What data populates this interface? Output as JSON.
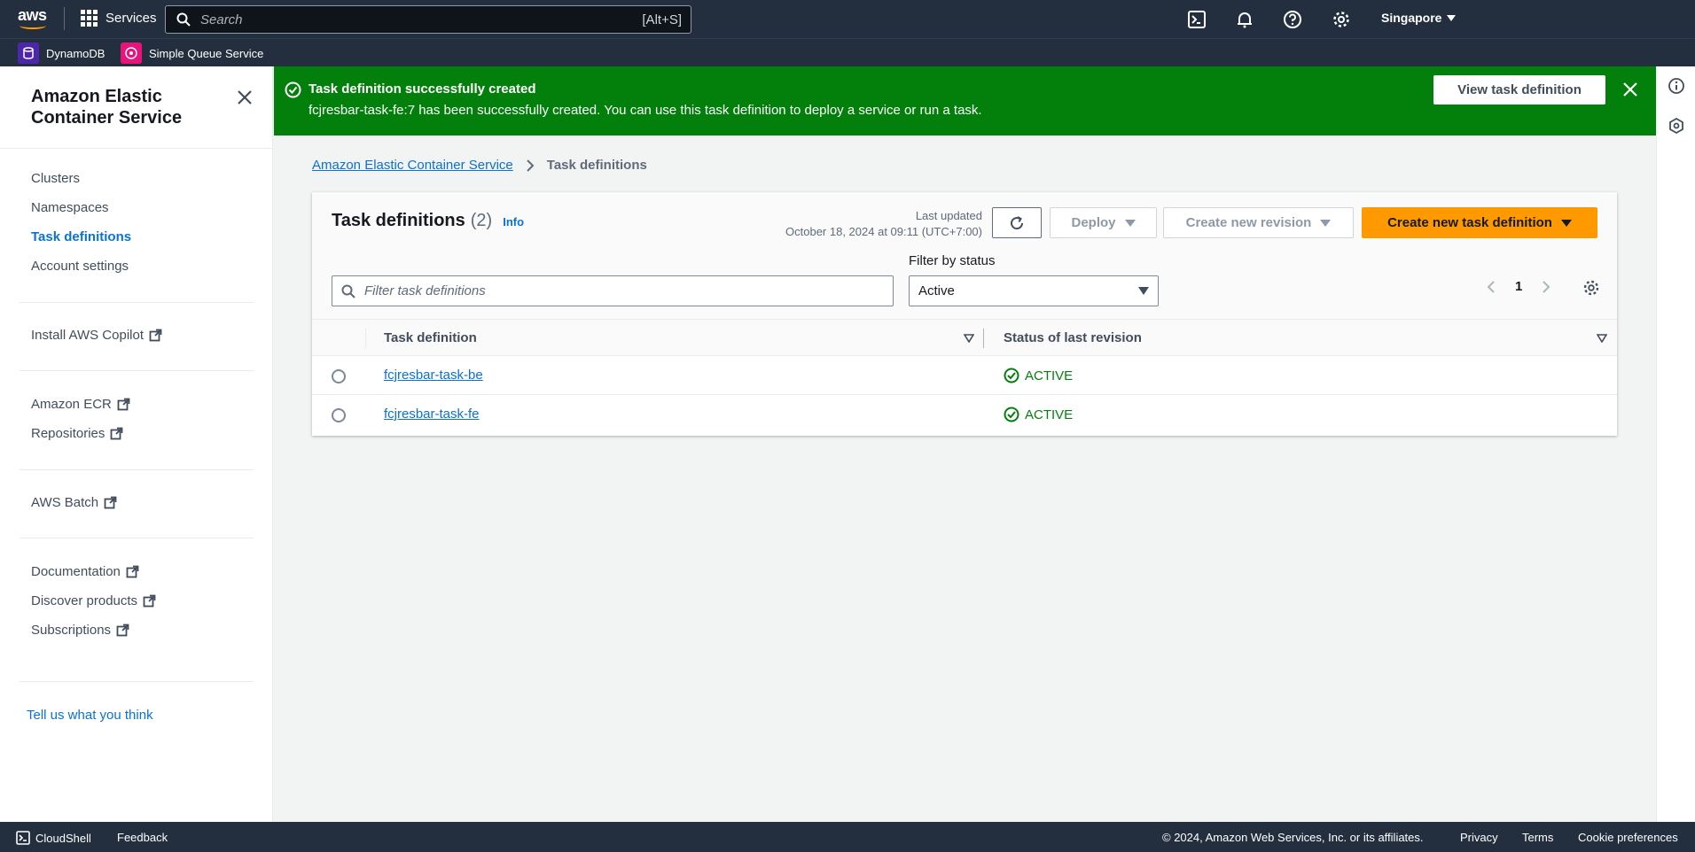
{
  "topnav": {
    "logo_text": "aws",
    "services_label": "Services",
    "search_placeholder": "Search",
    "search_shortcut": "[Alt+S]",
    "region": "Singapore"
  },
  "favorites": [
    {
      "label": "DynamoDB",
      "color": "#4d27aa"
    },
    {
      "label": "Simple Queue Service",
      "color": "#e7157b"
    }
  ],
  "sidebar": {
    "title": "Amazon Elastic Container Service",
    "groups": [
      [
        {
          "label": "Clusters",
          "active": false
        },
        {
          "label": "Namespaces",
          "active": false
        },
        {
          "label": "Task definitions",
          "active": true
        },
        {
          "label": "Account settings",
          "active": false
        }
      ],
      [
        {
          "label": "Install AWS Copilot",
          "external": true
        }
      ],
      [
        {
          "label": "Amazon ECR",
          "external": true
        },
        {
          "label": "Repositories",
          "external": true
        }
      ],
      [
        {
          "label": "AWS Batch",
          "external": true
        }
      ],
      [
        {
          "label": "Documentation",
          "external": true
        },
        {
          "label": "Discover products",
          "external": true
        },
        {
          "label": "Subscriptions",
          "external": true
        }
      ]
    ],
    "feedback": "Tell us what you think"
  },
  "flash": {
    "header": "Task definition successfully created",
    "body": "fcjresbar-task-fe:7 has been successfully created. You can use this task definition to deploy a service or run a task.",
    "button": "View task definition",
    "color": "#037f0c"
  },
  "breadcrumb": {
    "root": "Amazon Elastic Container Service",
    "current": "Task definitions"
  },
  "panel": {
    "title": "Task definitions",
    "count": "(2)",
    "info": "Info",
    "last_updated_label": "Last updated",
    "last_updated_value": "October 18, 2024 at 09:11 (UTC+7:00)",
    "deploy": "Deploy",
    "create_revision": "Create new revision",
    "create_new": "Create new task definition",
    "filter_placeholder": "Filter task definitions",
    "filter_status_label": "Filter by status",
    "filter_status_value": "Active",
    "page": "1",
    "columns": [
      "Task definition",
      "Status of last revision"
    ],
    "rows": [
      {
        "name": "fcjresbar-task-be",
        "status": "ACTIVE"
      },
      {
        "name": "fcjresbar-task-fe",
        "status": "ACTIVE"
      }
    ],
    "primary_color": "#ff9900"
  },
  "footer": {
    "cloudshell": "CloudShell",
    "feedback": "Feedback",
    "copyright": "© 2024, Amazon Web Services, Inc. or its affiliates.",
    "privacy": "Privacy",
    "terms": "Terms",
    "cookies": "Cookie preferences"
  }
}
